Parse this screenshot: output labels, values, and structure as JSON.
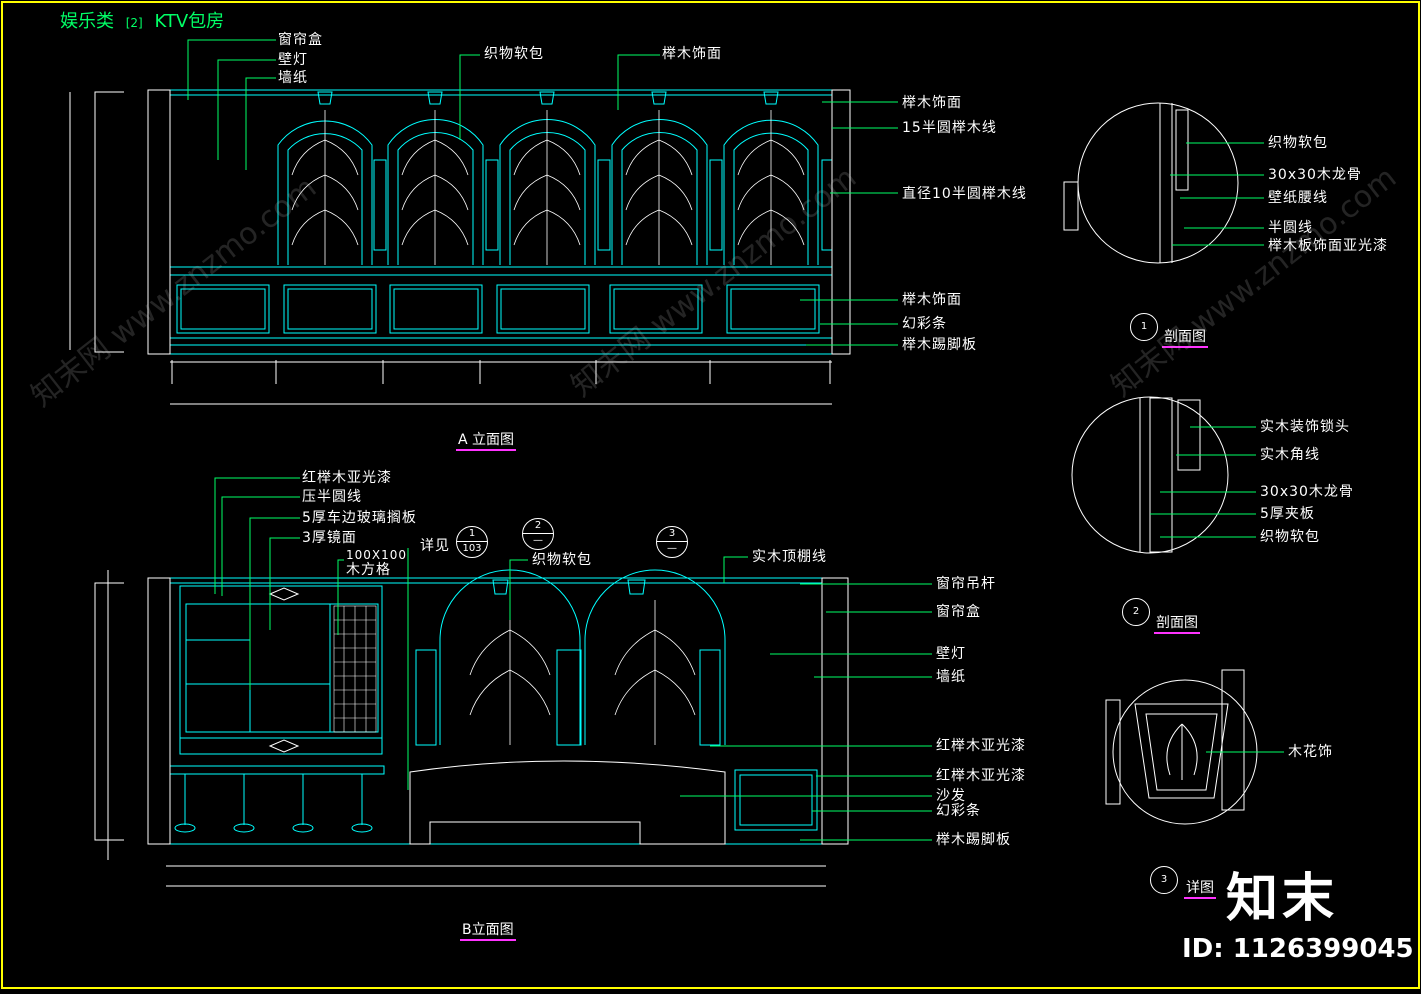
{
  "header": {
    "category": "娱乐类",
    "index": "[2]",
    "room": "KTV包房"
  },
  "elevation_a": {
    "caption": "A 立面图",
    "labels_left": [
      "窗帘盒",
      "壁灯",
      "墙纸"
    ],
    "labels_top": [
      "织物软包",
      "榉木饰面"
    ],
    "labels_right": [
      "榉木饰面",
      "15半圆榉木线",
      "直径10半圆榉木线",
      "榉木饰面",
      "幻彩条",
      "榉木踢脚板"
    ]
  },
  "elevation_b": {
    "caption": "B立面图",
    "labels_left": [
      "红榉木亚光漆",
      "压半圆线",
      "5厚车边玻璃搁板",
      "3厚镜面",
      "100X100",
      "木方格",
      "详见"
    ],
    "labels_top": [
      "织物软包",
      "实木顶棚线"
    ],
    "labels_right": [
      "窗帘吊杆",
      "窗帘盒",
      "壁灯",
      "墙纸",
      "红榉木亚光漆",
      "红榉木亚光漆",
      "沙发",
      "幻彩条",
      "榉木踢脚板"
    ],
    "bubbles": [
      {
        "top": "1",
        "bottom": "103"
      },
      {
        "top": "2",
        "bottom": "—"
      },
      {
        "top": "3",
        "bottom": "—"
      }
    ]
  },
  "section_1": {
    "number": "1",
    "caption": "剖面图",
    "labels": [
      "织物软包",
      "30x30木龙骨",
      "壁纸腰线",
      "半圆线",
      "榉木板饰面亚光漆"
    ]
  },
  "section_2": {
    "number": "2",
    "caption": "剖面图",
    "labels": [
      "实木装饰锁头",
      "实木角线",
      "30x30木龙骨",
      "5厚夹板",
      "织物软包"
    ]
  },
  "detail_3": {
    "number": "3",
    "caption": "详图",
    "labels": [
      "木花饰"
    ]
  },
  "watermark": {
    "brand": "知末",
    "id": "ID: 1126399045",
    "diag": "知末网 www.znzmo.com"
  },
  "colors": {
    "background": "#000000",
    "frame": "#ffff00",
    "line_cyan": "#00ffff",
    "leader_green": "#00ff66",
    "caption_underline": "#ff33ff",
    "text": "#ffffff"
  }
}
